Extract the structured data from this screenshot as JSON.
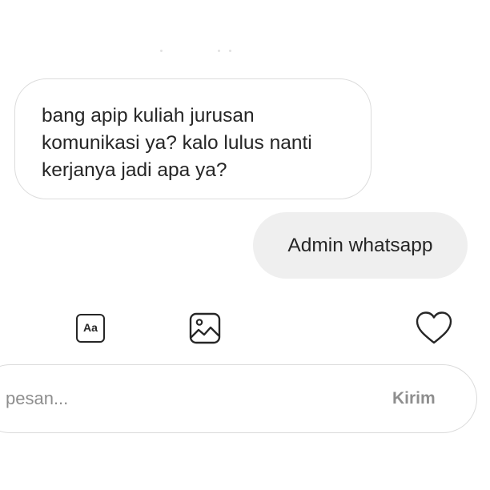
{
  "chat": {
    "incoming_message": {
      "lines": [
        "bang apip kuliah jurusan",
        "komunikasi ya? kalo lulus nanti",
        "kerjanya jadi apa ya?"
      ]
    },
    "outgoing_message": {
      "text": "Admin whatsapp"
    }
  },
  "toolbar": {
    "text_style_label": "Aa",
    "image_icon": "image-icon",
    "like_icon": "heart-icon"
  },
  "composer": {
    "placeholder": "pesan...",
    "send_label": "Kirim"
  },
  "colors": {
    "text": "#262626",
    "muted": "#8e8e8e",
    "outgoing_bubble": "#efefef",
    "border": "#dbdbdb"
  }
}
